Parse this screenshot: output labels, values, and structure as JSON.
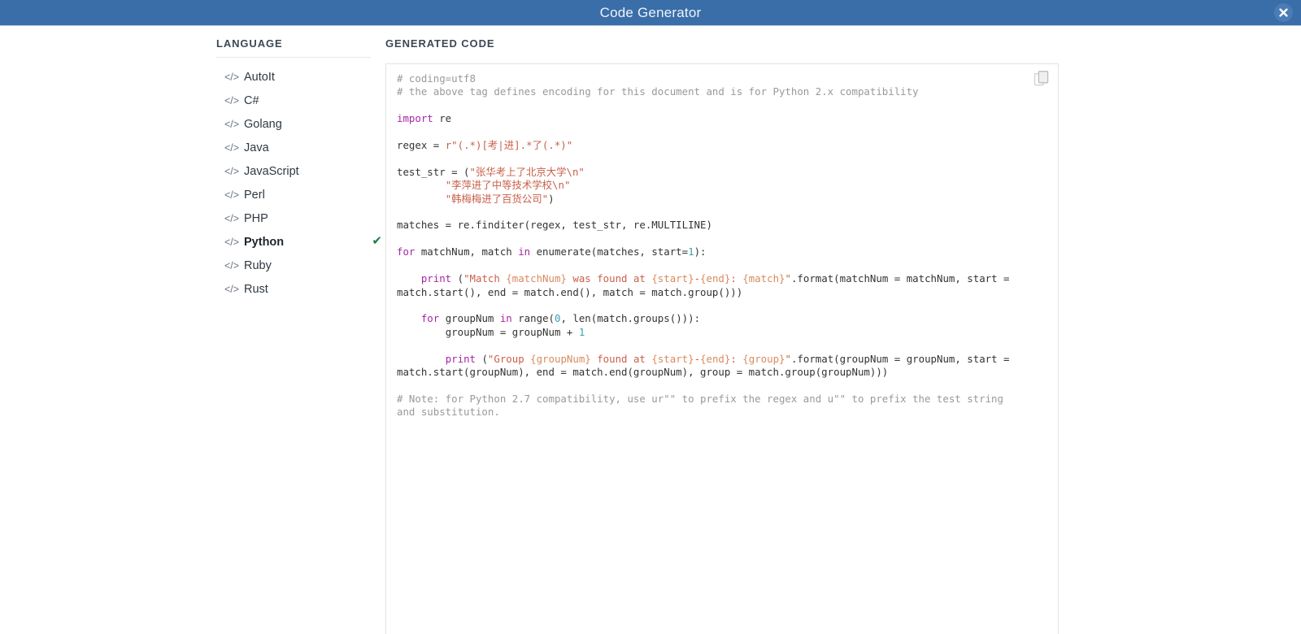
{
  "window": {
    "title": "Code Generator",
    "close_label": "×",
    "titlebar_color": "#3a6ea8"
  },
  "sidebar": {
    "heading": "LANGUAGE",
    "icon": "code-brackets-icon",
    "icon_glyph": "</>",
    "selected": "Python",
    "check_glyph": "✔",
    "check_color": "#1f7a45",
    "items": [
      {
        "label": "AutoIt",
        "selected": false
      },
      {
        "label": "C#",
        "selected": false
      },
      {
        "label": "Golang",
        "selected": false
      },
      {
        "label": "Java",
        "selected": false
      },
      {
        "label": "JavaScript",
        "selected": false
      },
      {
        "label": "Perl",
        "selected": false
      },
      {
        "label": "PHP",
        "selected": false
      },
      {
        "label": "Python",
        "selected": true
      },
      {
        "label": "Ruby",
        "selected": false
      },
      {
        "label": "Rust",
        "selected": false
      }
    ]
  },
  "main": {
    "heading": "GENERATED CODE",
    "copy_icon": "copy-icon",
    "code_lines": [
      "# coding=utf8",
      "# the above tag defines encoding for this document and is for Python 2.x compatibility",
      "",
      "import re",
      "",
      "regex = r\"(.*)[考|进].*了(.*)\"",
      "",
      "test_str = (\"张华考上了北京大学\\n\"",
      "        \"李萍进了中等技术学校\\n\"",
      "        \"韩梅梅进了百货公司\")",
      "",
      "matches = re.finditer(regex, test_str, re.MULTILINE)",
      "",
      "for matchNum, match in enumerate(matches, start=1):",
      "",
      "    print (\"Match {matchNum} was found at {start}-{end}: {match}\".format(matchNum = matchNum, start = match.start(), end = match.end(), match = match.group()))",
      "",
      "    for groupNum in range(0, len(match.groups())):",
      "        groupNum = groupNum + 1",
      "",
      "        print (\"Group {groupNum} found at {start}-{end}: {group}\".format(groupNum = groupNum, start = match.start(groupNum), end = match.end(groupNum), group = match.group(groupNum)))",
      "",
      "# Note: for Python 2.7 compatibility, use ur\"\" to prefix the regex and u\"\" to prefix the test string and substitution."
    ],
    "syntax_colors": {
      "comment": "#999999",
      "keyword": "#a626a4",
      "string": "#c8604a",
      "format_placeholder": "#d98a5e",
      "number": "#3aa3ad",
      "plain": "#333333"
    }
  }
}
